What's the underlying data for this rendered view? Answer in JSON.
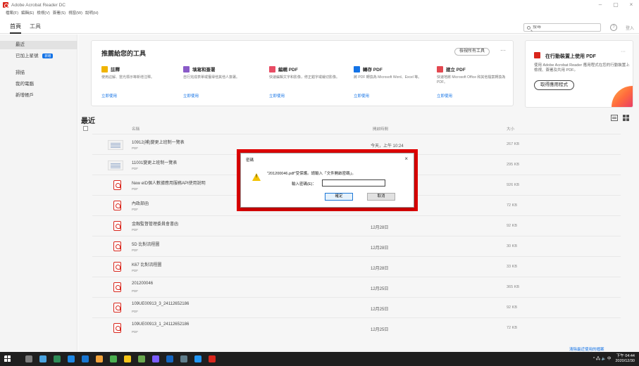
{
  "window": {
    "title": "Adobe Acrobat Reader DC",
    "controls": [
      "–",
      "▢",
      "×"
    ]
  },
  "menu": [
    "檔案(F)",
    "編輯(E)",
    "檢視(V)",
    "簽署(S)",
    "視窗(W)",
    "說明(H)"
  ],
  "tabs": [
    "首頁",
    "工具"
  ],
  "search": {
    "placeholder": "搜尋"
  },
  "help_label": "?",
  "signin_label": "登入",
  "sidebar": {
    "items": [
      {
        "label": "最近"
      },
      {
        "label": "已加上星號",
        "badge": "新增"
      },
      {
        "label": "掃描"
      },
      {
        "label": "我的電腦"
      },
      {
        "label": "新增帳戶"
      }
    ]
  },
  "recommended": {
    "title": "推薦給您的工具",
    "see_all": "檢視所有工具",
    "more": "···",
    "tools": [
      {
        "name": "註釋",
        "desc": "使用註解、當光標示等新增注釋。",
        "link": "立即使用",
        "color": "#f0b400"
      },
      {
        "name": "填寫和簽署",
        "desc": "自行完成表單或獲得他其他人簽署。",
        "link": "立即使用",
        "color": "#8a5bc8"
      },
      {
        "name": "編輯 PDF",
        "desc": "快速編輯文字和影像，修正錯字或裁切影像。",
        "link": "立即使用",
        "color": "#e84c64"
      },
      {
        "name": "轉存 PDF",
        "desc": "將 PDF 轉換為 Microsoft Word、Excel 等。",
        "link": "立即使用",
        "color": "#1473e6"
      },
      {
        "name": "建立 PDF",
        "desc": "快速地將 Microsoft Office 和其他檔案轉換為 PDF。",
        "link": "立即使用",
        "color": "#e34850"
      }
    ]
  },
  "promo": {
    "title": "在行動裝置上使用 PDF",
    "desc": "使用 Adobe Acrobat Reader 應用程式在您的行動裝置上檢視、簽署及共用 PDF。",
    "button": "取得應用程式",
    "more": "···"
  },
  "recent": {
    "title": "最近",
    "columns": {
      "name": "名稱",
      "opened": "開啟時間",
      "size": "大小"
    },
    "files": [
      {
        "name": "10912(補)變更上班制一覽表",
        "type": "PDF",
        "date": "今天，上午 10:24",
        "size": "267 KB",
        "icon": "doc"
      },
      {
        "name": "11001變更上班制一覽表",
        "type": "PDF",
        "date": "",
        "size": "295 KB",
        "icon": "doc"
      },
      {
        "name": "New eID個人數據應用服務API使用說明",
        "type": "PDF",
        "date": "",
        "size": "926 KB",
        "icon": "pdf"
      },
      {
        "name": "內政部函",
        "type": "PDF",
        "date": "",
        "size": "72 KB",
        "icon": "pdf"
      },
      {
        "name": "金融監督管理委員會書函",
        "type": "PDF",
        "date": "12月28日",
        "size": "92 KB",
        "icon": "pdf"
      },
      {
        "name": "5D 比對流程圖",
        "type": "PDF",
        "date": "12月28日",
        "size": "30 KB",
        "icon": "pdf"
      },
      {
        "name": "K67 比對流程圖",
        "type": "PDF",
        "date": "12月28日",
        "size": "33 KB",
        "icon": "pdf"
      },
      {
        "name": "201200046",
        "type": "PDF",
        "date": "12月25日",
        "size": "365 KB",
        "icon": "pdf"
      },
      {
        "name": "109UE00913_3_24112652186",
        "type": "PDF",
        "date": "12月25日",
        "size": "92 KB",
        "icon": "pdf"
      },
      {
        "name": "109UE00913_1_24112652186",
        "type": "PDF",
        "date": "12月25日",
        "size": "72 KB",
        "icon": "pdf"
      }
    ],
    "clear_link": "清除最近使用的檔案"
  },
  "dialog": {
    "title": "密碼",
    "close": "×",
    "message": "\"201200046.pdf\"受保護。請輸入「文件開啟密碼」。",
    "label": "輸入密碼(E)：",
    "ok": "確定",
    "cancel": "取消"
  },
  "taskbar": {
    "clock_time": "下午 04:44",
    "clock_date": "2020/12/30",
    "tray": "^ 🖧 🔈 中",
    "icon_colors": [
      "#ffffff",
      "#7d7d7d",
      "#4aa3df",
      "#2e8b57",
      "#1e88e5",
      "#1976d2",
      "#f3a33b",
      "#4caf50",
      "#f5c518",
      "#6aa84f",
      "#7b5cff",
      "#1565c0",
      "#607d8b",
      "#2196f3",
      "#d9261c"
    ]
  }
}
